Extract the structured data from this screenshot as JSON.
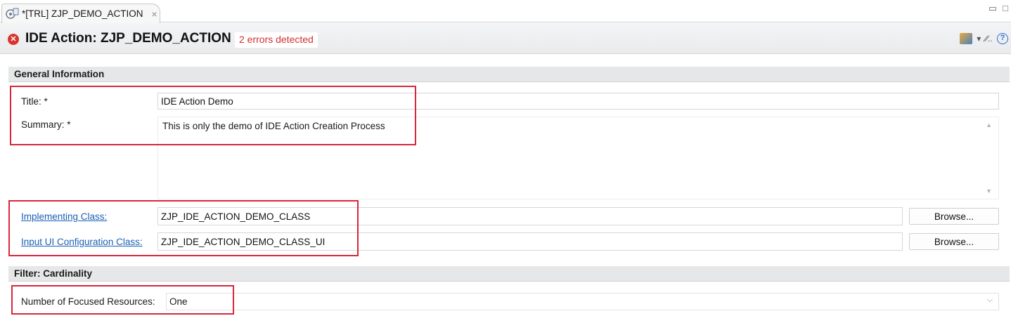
{
  "tab": {
    "label": "*[TRL] ZJP_DEMO_ACTION",
    "close_glyph": "×",
    "icon": "gear-doc-icon"
  },
  "window": {
    "minimize_glyph": "▭",
    "maximize_glyph": "□"
  },
  "header": {
    "error_icon": "error-x-icon",
    "title": "IDE Action: ZJP_DEMO_ACTION",
    "error_text": "2 errors detected",
    "menu_glyph": "▾",
    "tool_text": "∕∕..",
    "help_glyph": "?"
  },
  "general": {
    "section_title": "General Information",
    "title_label": "Title: *",
    "title_value": "IDE Action Demo",
    "summary_label": "Summary: *",
    "summary_value": "This is only the demo of IDE Action Creation Process",
    "scroll_up_glyph": "▲",
    "scroll_down_glyph": "▼",
    "impl_label": "Implementing Class:",
    "impl_value": "ZJP_IDE_ACTION_DEMO_CLASS",
    "browse_label": "Browse...",
    "input_ui_label": "Input UI Configuration Class:",
    "input_ui_value": "ZJP_IDE_ACTION_DEMO_CLASS_UI"
  },
  "filter": {
    "section_title": "Filter: Cardinality",
    "focused_label": "Number of Focused Resources:",
    "focused_value": "One",
    "dropdown_glyph": "⌵"
  },
  "colors": {
    "error_red": "#d32f2f",
    "highlight_red": "#d7263d",
    "link_blue": "#1a5fb4",
    "section_bg": "#e6e7e8"
  }
}
